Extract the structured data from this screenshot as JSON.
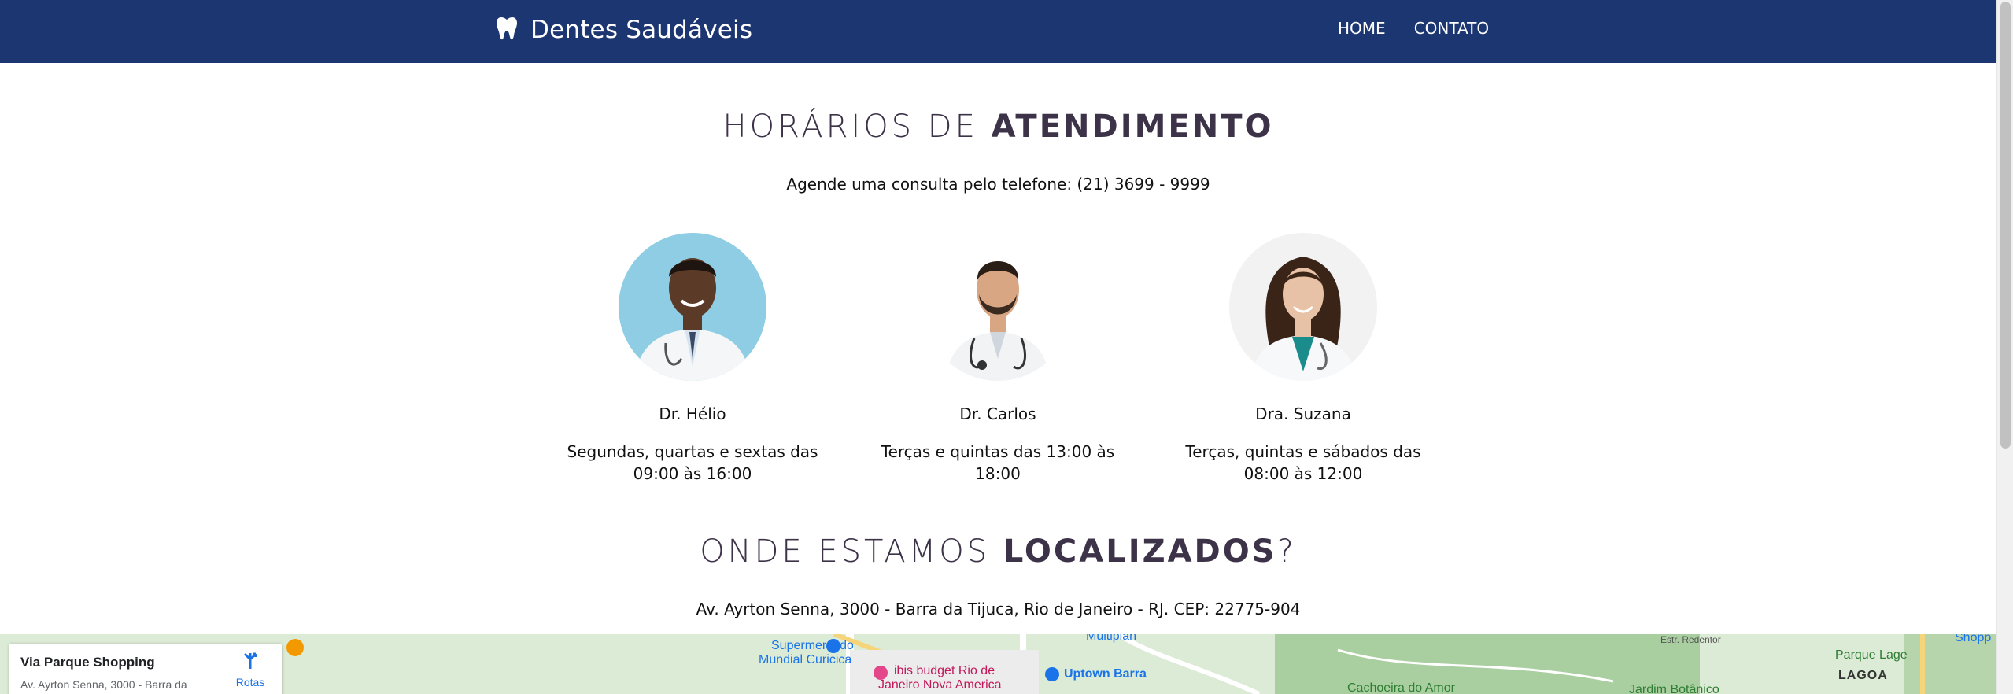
{
  "brand": {
    "name": "Dentes Saudáveis",
    "icon": "tooth-icon"
  },
  "nav": {
    "items": [
      "HOME",
      "CONTATO"
    ]
  },
  "schedule": {
    "title_light": "HORÁRIOS DE",
    "title_bold": "ATENDIMENTO",
    "phone_line": "Agende uma consulta pelo telefone: (21) 3699 - 9999",
    "doctors": [
      {
        "name": "Dr. Hélio",
        "hours": "Segundas, quartas e sextas das 09:00 às 16:00",
        "photo": "doctor-photo"
      },
      {
        "name": "Dr. Carlos",
        "hours": "Terças e quintas das 13:00 às 18:00",
        "photo": "doctor-photo"
      },
      {
        "name": "Dra. Suzana",
        "hours": "Terças, quintas e sábados das 08:00 às 12:00",
        "photo": "doctor-photo"
      }
    ]
  },
  "location": {
    "title_light": "ONDE ESTAMOS",
    "title_bold": "LOCALIZADOS",
    "title_suffix": "?",
    "address": "Av. Ayrton Senna, 3000 - Barra da Tijuca, Rio de Janeiro - RJ. CEP: 22775-904"
  },
  "map": {
    "card": {
      "place": "Via Parque Shopping",
      "address": "Av. Ayrton Senna, 3000 - Barra da",
      "route_label": "Rotas"
    },
    "labels": [
      "Supermercado",
      "Mundial Curicica",
      "ibis budget Rio de",
      "Janeiro Nova America",
      "Uptown Barra",
      "Multiplan",
      "Cachoeira do Amor",
      "Jardim Botânico",
      "Parque Lage",
      "LAGOA",
      "Estr. Redentor",
      "Shopp"
    ]
  },
  "colors": {
    "navbar": "#1c3672",
    "title": "#3d3349",
    "map_bg": "#d9ecd8",
    "link_blue": "#1a73e8"
  }
}
